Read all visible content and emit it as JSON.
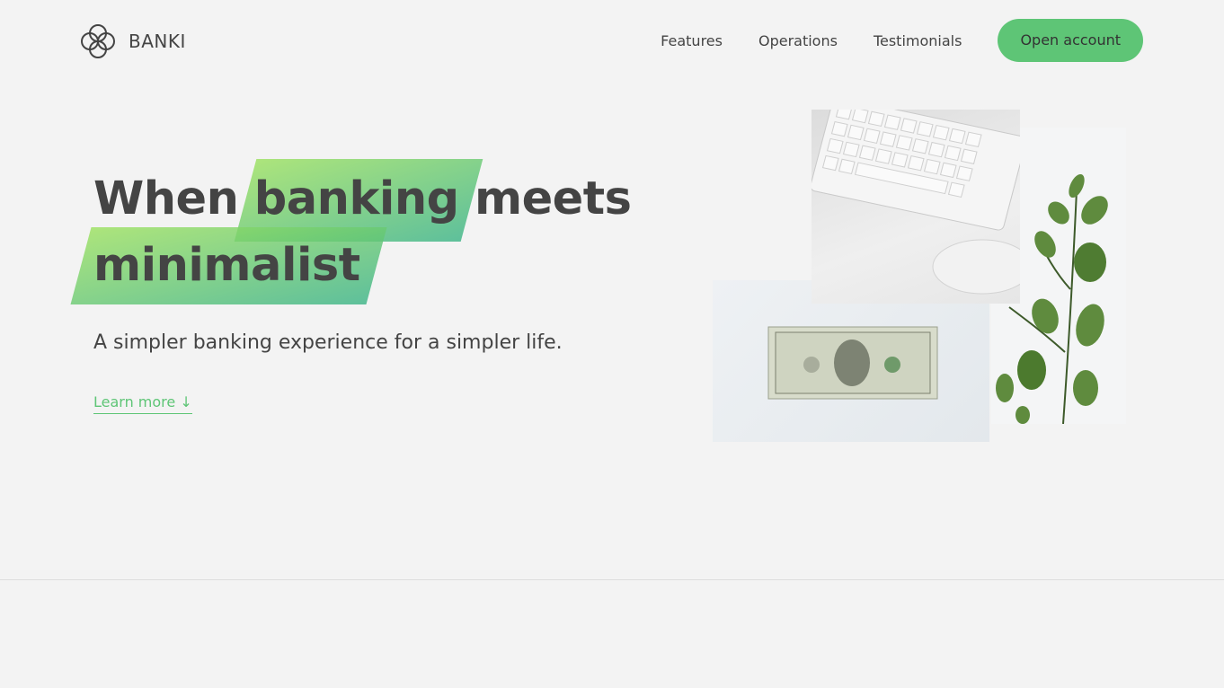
{
  "brand": {
    "name": "BANKI",
    "accent": "#5ec576"
  },
  "nav": {
    "links": [
      "Features",
      "Operations",
      "Testimonials"
    ],
    "cta": "Open account"
  },
  "hero": {
    "title_part1": "When",
    "title_highlight1": "banking",
    "title_part2": "meets",
    "title_highlight2": "minimalist",
    "subtitle": "A simpler banking experience for a simpler life.",
    "learn_more": "Learn more ↓"
  },
  "images": {
    "keyboard": "keyboard-and-mouse-photo",
    "money": "dollar-bill-photo",
    "plant": "eucalyptus-plant-photo"
  }
}
